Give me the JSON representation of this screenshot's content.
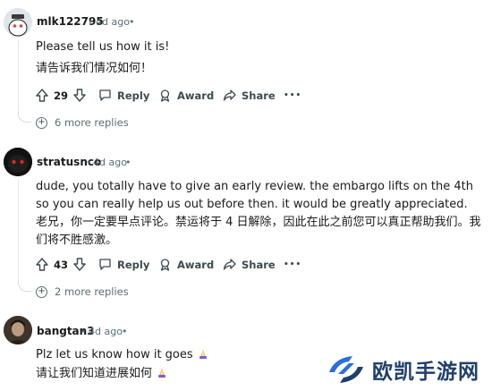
{
  "comments": [
    {
      "author": "mlk122795",
      "time": "4d ago",
      "text_en": "Please tell us how it is!",
      "text_zh": "请告诉我们情况如何！",
      "votes": "29",
      "reply_label": "Reply",
      "award_label": "Award",
      "share_label": "Share",
      "more_replies": "6 more replies"
    },
    {
      "author": "stratusnco",
      "time": "4d ago",
      "text_en": "dude, you totally have to give an early review. the embargo lifts on the 4th so you can really help us out before then. it would be greatly appreciated.",
      "text_zh": "老兄，你一定要早点评论。禁运将于 4 日解除，因此在此之前您可以真正帮助我们。我们将不胜感激。",
      "votes": "43",
      "reply_label": "Reply",
      "award_label": "Award",
      "share_label": "Share",
      "more_replies": "2 more replies"
    },
    {
      "author": "bangtan3",
      "time": "4d ago",
      "text_en": "Plz let us know how it goes",
      "text_zh": "请让我们知道进展如何"
    }
  ],
  "separator": "•",
  "overflow_glyph": "•••",
  "watermark": {
    "text": "欧凯手游网"
  },
  "colors": {
    "meta": "#576f76",
    "text": "#1a1a1b",
    "watermark": "#1f3f6a",
    "emoji": "#f2b134"
  },
  "icons": [
    "upvote-icon",
    "downvote-icon",
    "comment-icon",
    "award-icon",
    "share-icon",
    "more-icon",
    "plus-icon",
    "pray-emoji"
  ]
}
